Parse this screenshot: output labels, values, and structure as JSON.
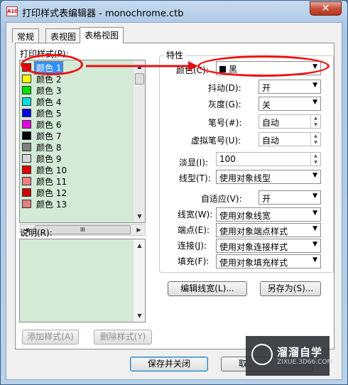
{
  "window": {
    "title": "打印样式表编辑器 - monochrome.ctb",
    "app_icon_text": "A10",
    "close_label": "✕"
  },
  "tabs": [
    {
      "label": "常规"
    },
    {
      "label": "表视图"
    },
    {
      "label": "表格视图"
    }
  ],
  "print_styles": {
    "label": "打印样式(P):",
    "items": [
      {
        "label": "颜色 1",
        "color": "#e00000"
      },
      {
        "label": "颜色 2",
        "color": "#ffff00"
      },
      {
        "label": "颜色 3",
        "color": "#00e000"
      },
      {
        "label": "颜色 4",
        "color": "#00e0e0"
      },
      {
        "label": "颜色 5",
        "color": "#0000e0"
      },
      {
        "label": "颜色 6",
        "color": "#e000e0"
      },
      {
        "label": "颜色 7",
        "color": "#000000"
      },
      {
        "label": "颜色 8",
        "color": "#7f7f7f"
      },
      {
        "label": "颜色 9",
        "color": "#d8d8d8"
      },
      {
        "label": "颜色 10",
        "color": "#e00000"
      },
      {
        "label": "颜色 11",
        "color": "#f08080"
      },
      {
        "label": "颜色 12",
        "color": "#d00000"
      },
      {
        "label": "颜色 13",
        "color": "#e08080"
      }
    ],
    "hscroll_grip": "III"
  },
  "description": {
    "label": "说明(R):"
  },
  "properties": {
    "group_title": "特性",
    "color_label": "颜色(C):",
    "color_value": "黑",
    "dither_label": "抖动(D):",
    "dither_value": "开",
    "grayscale_label": "灰度(G):",
    "grayscale_value": "关",
    "pen_label": "笔号(#):",
    "pen_value": "自动",
    "virtual_pen_label": "虚拟笔号(U):",
    "virtual_pen_value": "自动",
    "screening_label": "淡显(I):",
    "screening_value": "100",
    "linetype_label": "线型(T):",
    "linetype_value": "使用对象线型",
    "adaptive_label": "自适应(V):",
    "adaptive_value": "开",
    "lineweight_label": "线宽(W):",
    "lineweight_value": "使用对象线宽",
    "endstyle_label": "端点(E):",
    "endstyle_value": "使用对象端点样式",
    "joinstyle_label": "连接(J):",
    "joinstyle_value": "使用对象连接样式",
    "fillstyle_label": "填充(F):",
    "fillstyle_value": "使用对象填充样式"
  },
  "buttons": {
    "edit_lineweights": "编辑线宽(L)...",
    "save_as": "另存为(S)...",
    "add_style": "添加样式(A)",
    "delete_style": "删除样式(Y)",
    "save_close": "保存并关闭",
    "cancel_partial": "取"
  },
  "watermark": {
    "name": "溜溜自学",
    "url": "ZIXUE.3D66.COM"
  },
  "colors": {
    "annotation": "#e11111",
    "list_bg": "#d3ead6",
    "selection": "#3390ff"
  }
}
